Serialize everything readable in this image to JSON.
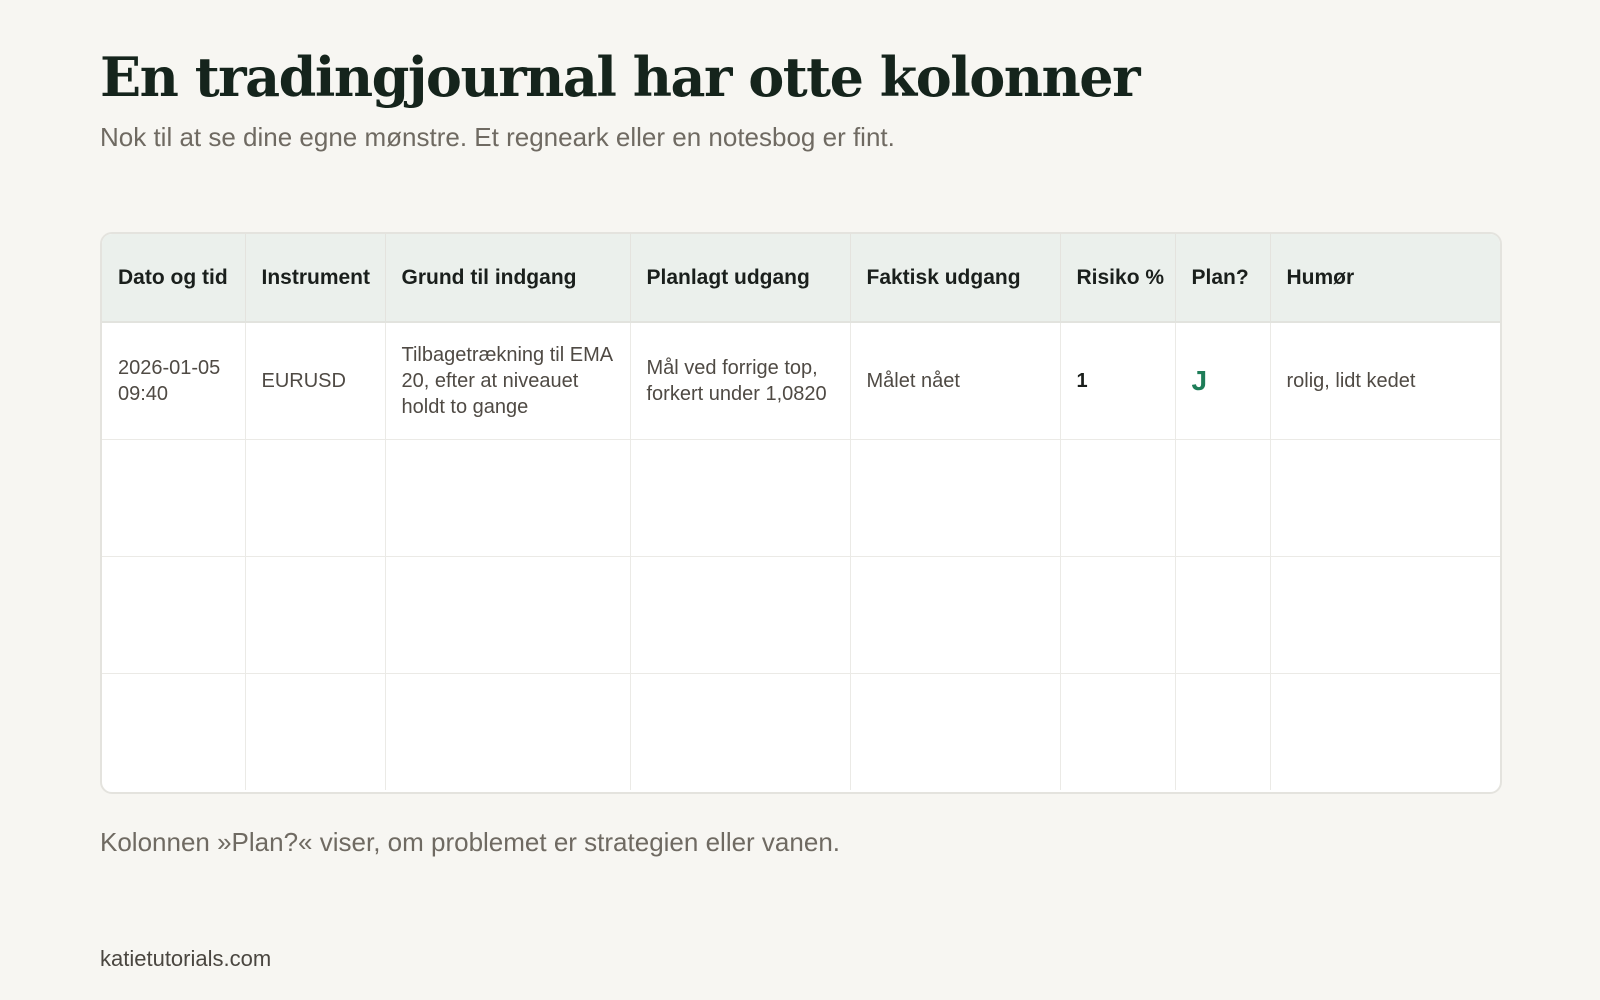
{
  "page": {
    "title": "En tradingjournal har otte kolonner",
    "subtitle": "Nok til at se dine egne mønstre. Et regneark eller en notesbog er fint.",
    "footnote": "Kolonnen »Plan?« viser, om problemet er strategien eller vanen.",
    "site": "katietutorials.com"
  },
  "table": {
    "headers": [
      "Dato og tid",
      "Instrument",
      "Grund til indgang",
      "Planlagt udgang",
      "Faktisk udgang",
      "Risiko %",
      "Plan?",
      "Humør"
    ],
    "rows": [
      {
        "datetime": "2026-01-05 09:40",
        "instrument": "EURUSD",
        "entry_reason": "Tilbagetrækning til EMA 20, efter at niveauet holdt to gange",
        "planned_exit": "Mål ved forrige top, forkert under 1,0820",
        "actual_exit": "Målet nået",
        "risk": "1",
        "plan": "J",
        "mood": "rolig, lidt kedet"
      }
    ],
    "empty_rows": 3
  },
  "colors": {
    "background": "#f7f6f2",
    "header_bg": "#ebf0ec",
    "title": "#15241c",
    "muted_text": "#6f6a62",
    "accent_green": "#1e7d58"
  }
}
